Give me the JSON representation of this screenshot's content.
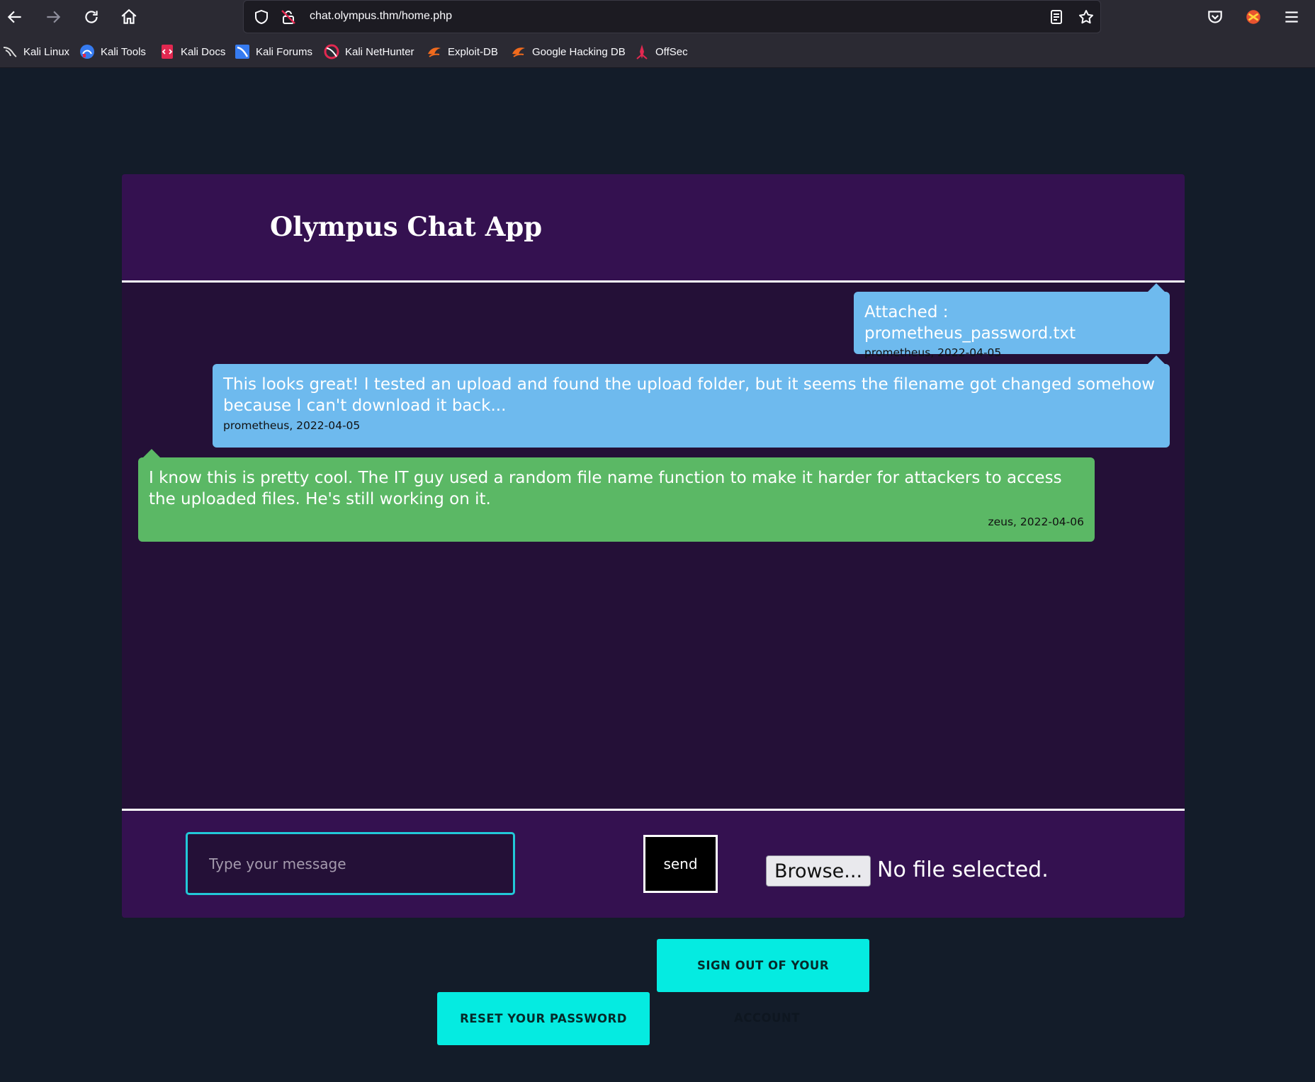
{
  "browser": {
    "url": "chat.olympus.thm/home.php",
    "bookmarks": [
      "Kali Linux",
      "Kali Tools",
      "Kali Docs",
      "Kali Forums",
      "Kali NetHunter",
      "Exploit-DB",
      "Google Hacking DB",
      "OffSec"
    ]
  },
  "app": {
    "title": "Olympus Chat App",
    "messages": [
      {
        "text": "Attached : prometheus_password.txt",
        "meta": "prometheus, 2022-04-05"
      },
      {
        "text": "This looks great! I tested an upload and found the upload folder, but it seems the filename got changed somehow because I can't download it back...",
        "meta": "prometheus, 2022-04-05"
      },
      {
        "text": "I know this is pretty cool. The IT guy used a random file name function to make it harder for attackers to access the uploaded files. He's still working on it.",
        "meta": "zeus, 2022-04-06"
      }
    ],
    "input_placeholder": "Type your message",
    "send_label": "send",
    "browse_label": "Browse...",
    "file_status": "No file selected.",
    "signout_label": "SIGN OUT OF YOUR",
    "signout_overflow": "ACCOUNT",
    "reset_label": "RESET YOUR PASSWORD"
  },
  "colors": {
    "page_bg": "#131c29",
    "card_bg": "#241037",
    "header_bg": "#341150",
    "blue_bubble": "#6ebaee",
    "green_bubble": "#5bb865",
    "accent": "#05ebe1"
  }
}
